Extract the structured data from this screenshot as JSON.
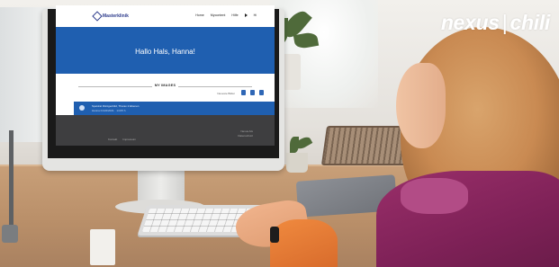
{
  "brand": {
    "left": "nexus",
    "separator": "|",
    "right": "chili"
  },
  "screen": {
    "logo": "Masterklinik",
    "nav": [
      "Home",
      "Mycontent",
      "Hilfe",
      "Hi"
    ],
    "greeting": "Hallo Hals, Hanna!",
    "section_title": "MY IMAGES",
    "section_sub": "Neueste Bilder",
    "item_title": "Spektral Röntgenbild, Thorax 2 Ebenen",
    "item_sub": "Hanna 01/22/2021 · 14:05 h",
    "footer_links": [
      "Kontakt",
      "Impressum"
    ],
    "footer_right": [
      "Nexus AG",
      "Datenschutz"
    ]
  },
  "colors": {
    "screen_blue": "#1f5fb0",
    "footer_gray": "#3e3e40",
    "sweater": "#7e2157",
    "sleeve": "#f08a3f"
  }
}
